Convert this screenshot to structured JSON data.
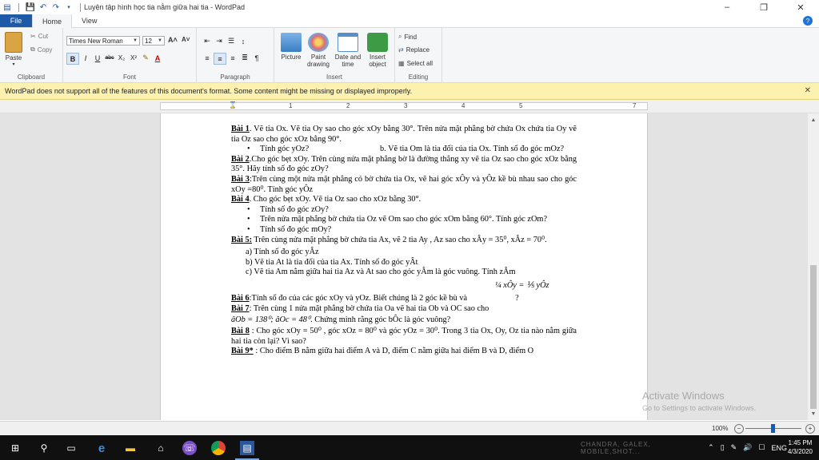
{
  "window": {
    "title": "Luyện tập hình học tia nằm giữa hai tia - WordPad",
    "controls": [
      "–",
      "❐",
      "✕"
    ]
  },
  "tabs": {
    "file": "File",
    "home": "Home",
    "view": "View",
    "help": "?"
  },
  "ribbon": {
    "clipboard": {
      "label": "Clipboard",
      "paste": "Paste",
      "cut": "Cut",
      "copy": "Copy"
    },
    "font": {
      "label": "Font",
      "family": "Times New Roman",
      "size": "12",
      "grow": "A˄",
      "shrink": "A˅",
      "bold": "B",
      "italic": "I",
      "underline": "U",
      "strike": "abc",
      "subscript": "X₂",
      "superscript": "X²",
      "highlight": "✎",
      "color": "A"
    },
    "paragraph": {
      "label": "Paragraph"
    },
    "insert": {
      "label": "Insert",
      "picture": "Picture",
      "paint": "Paint\ndrawing",
      "datetime": "Date and\ntime",
      "object": "Insert\nobject"
    },
    "editing": {
      "label": "Editing",
      "find": "Find",
      "replace": "Replace",
      "select_all": "Select all"
    }
  },
  "infobar": {
    "message": "WordPad does not support all of the features of this document's format. Some content might be missing or displayed improperly.",
    "close": "✕"
  },
  "ruler": {
    "numbers": [
      "1",
      "2",
      "3",
      "4",
      "5",
      "7"
    ]
  },
  "doc": {
    "b1_title": "Bài 1",
    "b1_text": ". Vẽ tia Ox. Vẽ tia Oy sao cho góc xOy bằng 30°. Trên nửa mặt phẳng bờ chứa Ox chứa tia Oy vẽ tia Oz sao cho góc xOz bằng 90°.",
    "b1_a": "Tính góc yOz?",
    "b1_b": "b. Vẽ tia Om là tia đối của tia Ox. Tính số đo góc mOz?",
    "b2_title": "Bài 2",
    "b2_text": ".Cho góc bẹt xOy. Trên cùng nửa mặt phẳng bờ là đường thẳng xy vẽ tia Oz sao cho góc xOz bằng 35°. Hãy tính số đo góc zOy?",
    "b3_title": "Bài 3",
    "b3_text": ":Trên cùng một nửa mặt phẳng có bờ chứa tia Ox, vẽ hai góc xÔy và yÔz kề bù nhau sao cho góc xOy =80⁰. Tính góc  yÔz",
    "b4_title": "Bài 4",
    "b4_text": ". Cho góc bẹt xOy. Vẽ tia Oz sao cho xOz bằng 30°.",
    "b4_1": "Tính số đo góc zOy?",
    "b4_2": "Trên nửa mặt phẳng bờ chứa tia Oz vẽ Om sao cho góc xOm bằng 60°. Tính góc zOm?",
    "b4_3": "Tính số đo góc mOy?",
    "b5_title": "Bài 5:",
    "b5_text": " Trên cùng nửa mặt phẳng bờ chứa tia Ax, vẽ 2 tia Ay , Az sao cho xÂy = 35⁰, xÂz = 70⁰.",
    "b5_a": "a)  Tính số đo góc yÂz",
    "b5_b": "b)  Vẽ tia At là tia đối của tia Ax. Tính số đo góc yÂt",
    "b5_c": "c)  Vẽ tia Am nằm giữa hai tia Az và At sao cho góc yÂm là góc vuông. Tính  zÂm",
    "formula": "¼ xÔy = ⅕ yÔz",
    "b6_title": "Bài 6",
    "b6_text": ":Tính số đo của các góc xOy và yOz. Biết chúng là 2 góc kề bù và",
    "b6_end": "?",
    "b7_title": "Bài 7",
    "b7_text": ": Trên cùng 1 nửa mặt phẳng bờ chứa tia Oa vẽ hai tia Ob và OC sao cho",
    "b7_eq": "âOb = 138⁰; âOc = 48⁰",
    "b7_end": ". Chứng minh rằng góc  bÔc  là góc vuông?",
    "b8_title": "Bài 8",
    "b8_text": " :  Cho góc xOy = 50⁰ , góc xOz = 80⁰ và góc yOz = 30⁰. Trong 3 tia Ox, Oy, Oz tia nào nằm giữa hai tia còn lại? Vì sao?",
    "b9_title": "Bài 9*",
    "b9_text": " : Cho điểm B nằm giữa hai điểm A và D, điểm C nằm giữa hai điểm B và D, điểm O"
  },
  "watermark": {
    "line1": "Activate Windows",
    "line2": "Go to Settings to activate Windows."
  },
  "status": {
    "zoom": "100%"
  },
  "taskbar": {
    "search_text": "CHANDRA, GALEX, MOBILE,SHOT...",
    "lang": "ENG",
    "time": "1:45 PM",
    "date": "4/3/2020"
  }
}
